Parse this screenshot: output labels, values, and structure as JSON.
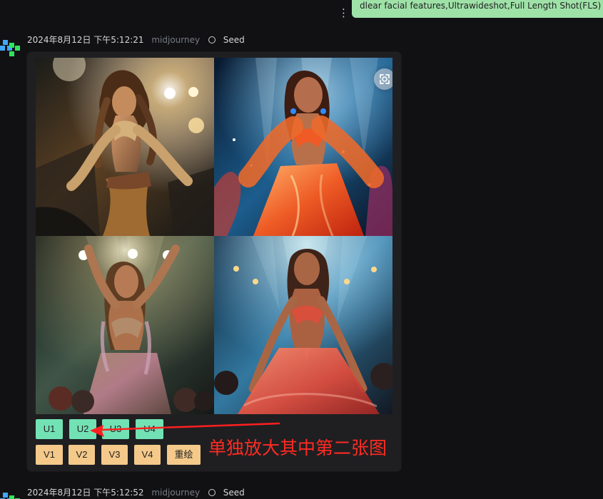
{
  "top_prompt": {
    "text": "dlear facial features,Ultrawideshot,Full Length Shot(FLS)",
    "more_icon": "vertical-ellipsis-icon"
  },
  "messages": [
    {
      "timestamp": "2024年8月12日 下午5:12:21",
      "author": "midjourney",
      "seed_label": "Seed"
    },
    {
      "timestamp": "2024年8月12日 下午5:12:52",
      "author": "midjourney",
      "seed_label": "Seed"
    }
  ],
  "image_card": {
    "images": [
      "dancer-image-1",
      "dancer-image-2",
      "dancer-image-3",
      "dancer-image-4"
    ],
    "scan_icon": "focus-frame-icon",
    "upscale_buttons": [
      "U1",
      "U2",
      "U3",
      "U4"
    ],
    "variation_buttons": [
      "V1",
      "V2",
      "V3",
      "V4",
      "重绘"
    ]
  },
  "annotation": {
    "text": "单独放大其中第二张图",
    "color": "#ff2b22"
  },
  "colors": {
    "background": "#111114",
    "card": "#1f1f22",
    "prompt_bubble": "#9fe2a8",
    "upscale_button": "#72e2b5",
    "variation_button": "#f4c98a"
  }
}
